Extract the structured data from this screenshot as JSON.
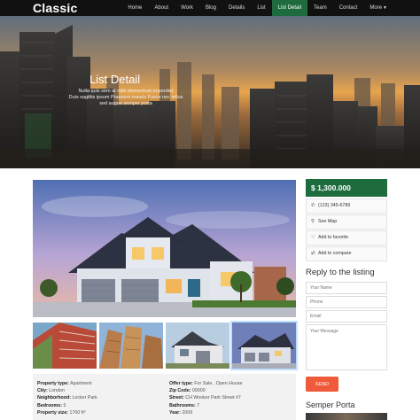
{
  "brand": "Classic",
  "nav": {
    "items": [
      "Home",
      "About",
      "Work",
      "Blog",
      "Details",
      "List",
      "List Detail",
      "Team",
      "Contact",
      "More"
    ],
    "active": "List Detail"
  },
  "hero": {
    "title": "List Detail",
    "subtitle_lines": [
      "Nulla quis sem at nibh elementum imperdiet",
      "Duis sagittis ipsum Praesent mauris Fusce nec tellus",
      "sed augue semper porta"
    ]
  },
  "sidebar": {
    "price": "$ 1,300.000",
    "items": [
      {
        "icon": "phone-icon",
        "label": "(123) 345-6789"
      },
      {
        "icon": "map-pin-icon",
        "label": "See Map"
      },
      {
        "icon": "heart-icon",
        "label": "Add to favorite"
      },
      {
        "icon": "compare-icon",
        "label": "Add to compare"
      }
    ],
    "reply_title": "Reply to the listing",
    "form": {
      "name_placeholder": "Your Name",
      "phone_placeholder": "Phone",
      "email_placeholder": "Email",
      "message_placeholder": "Your Message",
      "send_label": "SEND"
    },
    "semper_title": "Semper Porta"
  },
  "properties": {
    "left": [
      {
        "label": "Property type:",
        "value": "Apartment"
      },
      {
        "label": "City:",
        "value": "London"
      },
      {
        "label": "Neighborhood:",
        "value": "Locker Park"
      },
      {
        "label": "Bedrooms:",
        "value": "5"
      },
      {
        "label": "Property size:",
        "value": "1700 ft²"
      }
    ],
    "right": [
      {
        "label": "Offer type:",
        "value": "For Sale , Open House"
      },
      {
        "label": "Zip Code:",
        "value": "00000"
      },
      {
        "label": "Street:",
        "value": "CH Wooker Park Street #7"
      },
      {
        "label": "Bathrooms:",
        "value": "7"
      },
      {
        "label": "Year:",
        "value": "2009"
      }
    ]
  },
  "colors": {
    "accent_green": "#1e6b3e",
    "send_orange": "#ef5b3a",
    "navbar": "#111111"
  }
}
